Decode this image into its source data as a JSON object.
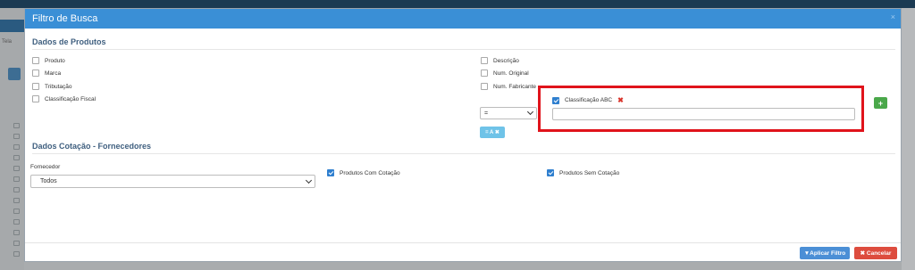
{
  "background": {
    "tela_label": "Tela"
  },
  "modal": {
    "title": "Filtro de Busca",
    "close_glyph": "×",
    "produtos": {
      "section_title": "Dados de Produtos",
      "left_checks": [
        "Produto",
        "Marca",
        "Tributação",
        "Classificação Fiscal"
      ],
      "right_checks": [
        "Descrição",
        "Num. Original",
        "Num. Fabricante"
      ],
      "abc": {
        "label": "Classificação ABC",
        "checked": true,
        "remove_glyph": "✖",
        "value": ""
      },
      "operator_select": "=",
      "tag_button": "= A ✖",
      "add_button": "+"
    },
    "cotacao": {
      "section_title": "Dados Cotação - Fornecedores",
      "fornecedor_label": "Fornecedor",
      "fornecedor_value": "Todos",
      "com_cotacao": "Produtos Com Cotação",
      "sem_cotacao": "Produtos Sem Cotação"
    },
    "footer": {
      "apply": "▼Aplicar Filtro",
      "cancel": "✖ Cancelar"
    }
  },
  "colors": {
    "header": "#3a8fd6",
    "highlight": "#e0131b",
    "apply": "#4b8fd6",
    "cancel": "#dd4c3e",
    "add": "#4aa84a"
  },
  "icons": [
    "close-icon",
    "remove-icon",
    "chevron-down-icon",
    "plus-icon",
    "filter-icon",
    "check-icon"
  ]
}
